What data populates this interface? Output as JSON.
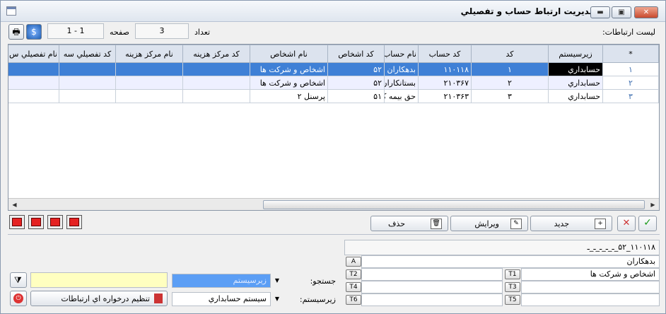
{
  "window": {
    "title": "مديريت ارتباط حساب و تفصيلي"
  },
  "header": {
    "list_label": "ليست ارتباطات:",
    "count_label": "تعداد",
    "count_value": "3",
    "page_label": "صفحه",
    "page_value": "1 - 1"
  },
  "grid": {
    "columns": [
      "*",
      "زيرسيستم",
      "كد",
      "كد حساب",
      "نام حساب",
      "كد اشخاص",
      "نام اشخاص",
      "كد مركز هزينه",
      "نام مركز هزينه",
      "كد تفصيلي سه",
      "نام تفصيلي س"
    ],
    "rows": [
      {
        "num": "۱",
        "subsystem": "حسابداري",
        "code": "۱",
        "account_code": "۱۱۰۱۱۸",
        "account_name": "بدهكاران",
        "person_code": "۵۲",
        "person_name": "اشخاص و شركت ها"
      },
      {
        "num": "۲",
        "subsystem": "حسابداري",
        "code": "۲",
        "account_code": "۲۱۰۳۶۷",
        "account_name": "بستانكاران مزايده",
        "person_code": "۵۲",
        "person_name": "اشخاص و شركت ها"
      },
      {
        "num": "۳",
        "subsystem": "حسابداري",
        "code": "۳",
        "account_code": "۲۱۰۳۶۳",
        "account_name": "حق بيمه كاركنان و پزشكان",
        "person_code": "۵۱",
        "person_name": "پرسنل ۲"
      }
    ]
  },
  "actions": {
    "new": "جديد",
    "edit": "ويرايش",
    "delete": "حذف"
  },
  "detail": {
    "path": "۱۱۰۱۱۸_۵۲_ـ_ـ_ـ_ـ_ـ",
    "account": "بدهكاران",
    "t1": "اشخاص و شركت ها",
    "keys": [
      "A",
      "T1",
      "T2",
      "T3",
      "T4",
      "T5",
      "T6"
    ]
  },
  "search": {
    "label": "جستجو:",
    "value": "زيرسيستم",
    "subsystem_label": "زيرسيستم:",
    "subsystem_value": "سيستم حسابداري",
    "settings_button": "تنظيم درخواره اي ارتباطات"
  },
  "colors": {
    "selection": "#3f80d6",
    "highlight": "#ffffc0",
    "search_field": "#5b9ef5"
  }
}
